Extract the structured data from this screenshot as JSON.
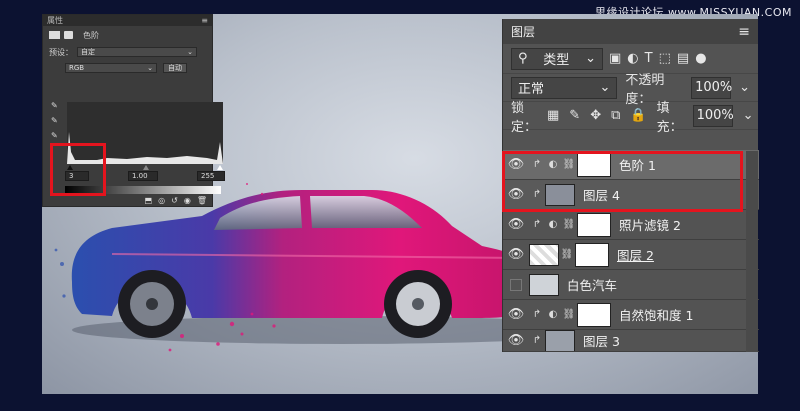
{
  "watermark": "思缘设计论坛 www.MISSYUAN.COM",
  "properties": {
    "title": "属性",
    "adjustment_name": "色阶",
    "preset_label": "预设：",
    "preset_value": "自定",
    "channel_value": "RGB",
    "auto_label": "自动",
    "input_black": "3",
    "input_gamma": "1.00",
    "input_white": "255"
  },
  "layers": {
    "tab": "图层",
    "filter_kind": "类型",
    "blend_mode": "正常",
    "opacity_label": "不透明度：",
    "opacity_value": "100%",
    "lock_label": "锁定：",
    "fill_label": "填充：",
    "fill_value": "100%",
    "items": [
      {
        "name": "色阶 1"
      },
      {
        "name": "图层 4"
      },
      {
        "name": "照片滤镜 2"
      },
      {
        "name": "图层 2"
      },
      {
        "name": "白色汽车"
      },
      {
        "name": "自然饱和度 1"
      },
      {
        "name": "图层 3"
      }
    ]
  },
  "colors": {
    "highlight": "#e4141e",
    "accent_pink": "#e0177a",
    "panel": "#535353"
  }
}
